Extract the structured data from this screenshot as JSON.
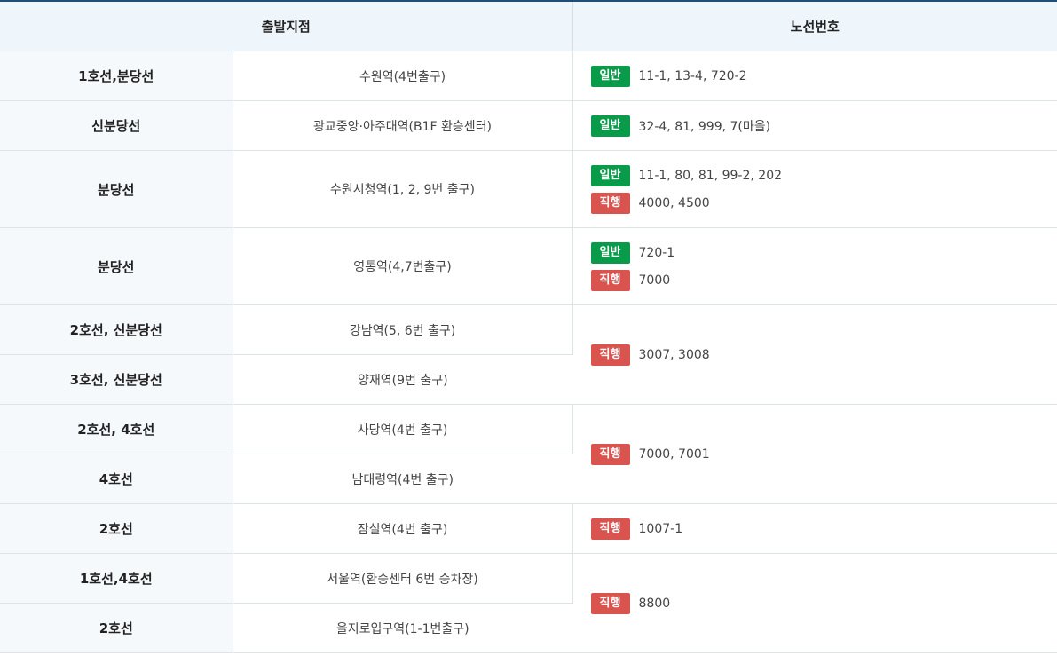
{
  "headers": {
    "origin": "출발지점",
    "route_no": "노선번호"
  },
  "badges": {
    "general": "일반",
    "express": "직행"
  },
  "colors": {
    "general": "#0a9b4a",
    "express": "#d9534f",
    "header_bg": "#eef5fb",
    "line_bg": "#f6f9fc"
  },
  "rows": [
    {
      "line": "1호선,분당선",
      "station": "수원역(4번출구)"
    },
    {
      "line": "신분당선",
      "station": "광교중앙·아주대역(B1F 환승센터)"
    },
    {
      "line": "분당선",
      "station": "수원시청역(1, 2, 9번 출구)"
    },
    {
      "line": "분당선",
      "station": "영통역(4,7번출구)"
    },
    {
      "line": "2호선, 신분당선",
      "station": "강남역(5, 6번 출구)"
    },
    {
      "line": "3호선, 신분당선",
      "station": "양재역(9번 출구)"
    },
    {
      "line": "2호선, 4호선",
      "station": "사당역(4번 출구)"
    },
    {
      "line": "4호선",
      "station": "남태령역(4번 출구)"
    },
    {
      "line": "2호선",
      "station": "잠실역(4번 출구)"
    },
    {
      "line": "1호선,4호선",
      "station": "서울역(환승센터 6번 승차장)"
    },
    {
      "line": "2호선",
      "station": "을지로입구역(1-1번출구)"
    }
  ],
  "routes": {
    "r0_general": "11-1, 13-4, 720-2",
    "r1_general": "32-4, 81, 999, 7(마을)",
    "r2_general": "11-1, 80, 81, 99-2, 202",
    "r2_express": "4000, 4500",
    "r3_general": "720-1",
    "r3_express": "7000",
    "r4_express": "3007, 3008",
    "r6_express": "7000, 7001",
    "r8_express": "1007-1",
    "r9_express": "8800"
  }
}
